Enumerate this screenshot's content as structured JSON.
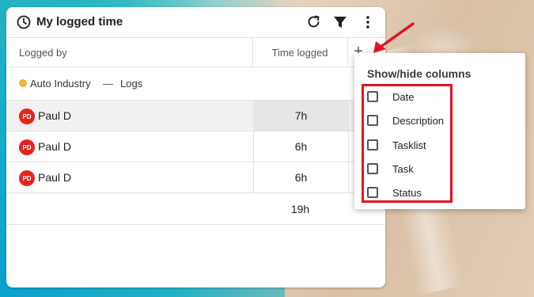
{
  "colors": {
    "accent_red": "#e0161f",
    "avatar_red": "#e8231d",
    "project_dot": "#f5b13d"
  },
  "panel": {
    "title": "My logged time",
    "icons": {
      "title": "clock-icon",
      "refresh": "refresh-icon",
      "filter": "filter-icon",
      "more": "more-vertical-icon"
    },
    "columns": {
      "logged_by": "Logged by",
      "time_logged": "Time logged",
      "add": "+"
    },
    "group": {
      "project": "Auto Industry",
      "separator": "—",
      "tasklist": "Logs"
    },
    "rows": [
      {
        "initials": "PD",
        "name": "Paul D",
        "time": "7h"
      },
      {
        "initials": "PD",
        "name": "Paul D",
        "time": "6h"
      },
      {
        "initials": "PD",
        "name": "Paul D",
        "time": "6h"
      }
    ],
    "total": "19h"
  },
  "dropdown": {
    "title": "Show/hide columns",
    "options": [
      {
        "label": "Date",
        "checked": false
      },
      {
        "label": "Description",
        "checked": false
      },
      {
        "label": "Tasklist",
        "checked": false
      },
      {
        "label": "Task",
        "checked": false
      },
      {
        "label": "Status",
        "checked": false
      }
    ]
  }
}
